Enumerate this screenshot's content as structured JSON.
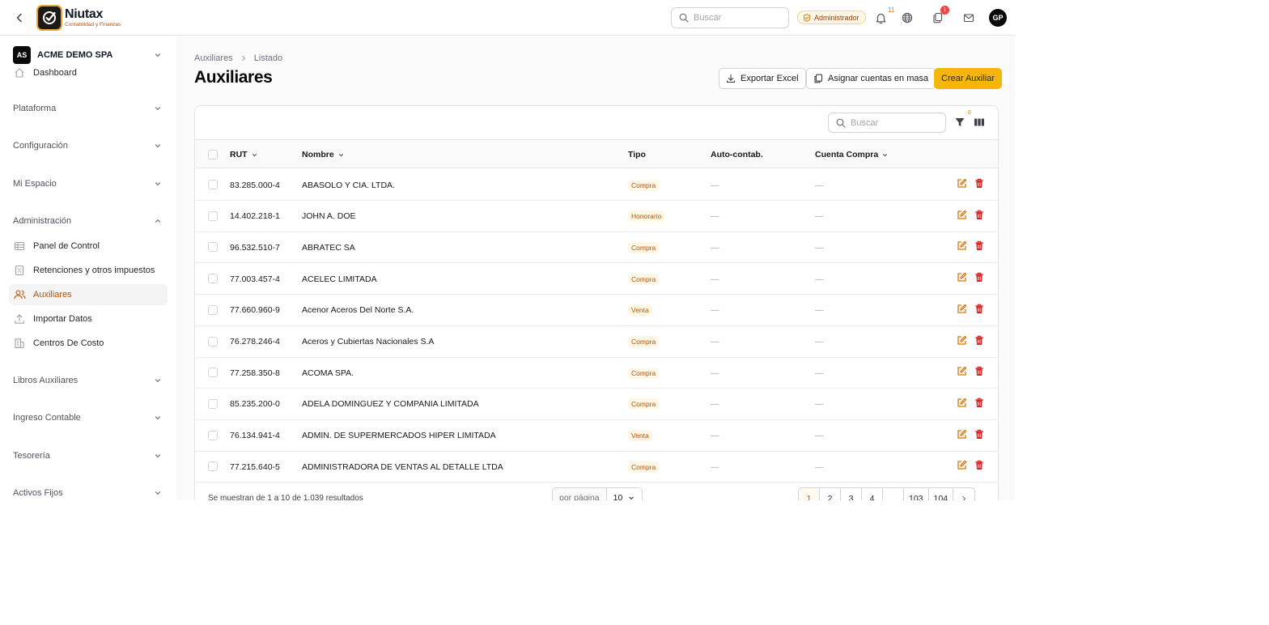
{
  "topbar": {
    "logo_name": "Niutax",
    "logo_subtitle": "Contabilidad y Finanzas",
    "search_placeholder": "Buscar",
    "role_badge": "Administrador",
    "notifications_count": "11",
    "tasks_count": "1",
    "user_initials": "GP"
  },
  "sidebar": {
    "company_initials": "AS",
    "company_name": "ACME DEMO SPA",
    "dashboard_label": "Dashboard",
    "sections": [
      {
        "label": "Plataforma",
        "expanded": false
      },
      {
        "label": "Configuración",
        "expanded": false
      },
      {
        "label": "Mi Espacio",
        "expanded": false
      },
      {
        "label": "Administración",
        "expanded": true
      },
      {
        "label": "Libros Auxiliares",
        "expanded": false
      },
      {
        "label": "Ingreso Contable",
        "expanded": false
      },
      {
        "label": "Tesorería",
        "expanded": false
      },
      {
        "label": "Activos Fijos",
        "expanded": false
      }
    ],
    "admin_items": [
      {
        "label": "Panel de Control",
        "icon": "table-icon"
      },
      {
        "label": "Retenciones y otros impuestos",
        "icon": "receipt-icon"
      },
      {
        "label": "Auxiliares",
        "icon": "users-icon",
        "active": true
      },
      {
        "label": "Importar Datos",
        "icon": "upload-icon"
      },
      {
        "label": "Centros De Costo",
        "icon": "building-icon"
      }
    ]
  },
  "breadcrumb": [
    "Auxiliares",
    "Listado"
  ],
  "page_title": "Auxiliares",
  "actions": {
    "export": "Exportar Excel",
    "assign": "Asignar cuentas en masa",
    "create": "Crear Auxiliar"
  },
  "table": {
    "search_placeholder": "Buscar",
    "filter_count": "0",
    "columns": {
      "rut": "RUT",
      "nombre": "Nombre",
      "tipo": "Tipo",
      "auto": "Auto-contab.",
      "cuenta": "Cuenta Compra"
    },
    "rows": [
      {
        "rut": "83.285.000-4",
        "nombre": "ABASOLO Y CIA. LTDA.",
        "tipo": "Compra",
        "auto": "—",
        "cuenta": "—"
      },
      {
        "rut": "14.402.218-1",
        "nombre": "JOHN A. DOE",
        "tipo": "Honorario",
        "auto": "—",
        "cuenta": "—"
      },
      {
        "rut": "96.532.510-7",
        "nombre": "ABRATEC SA",
        "tipo": "Compra",
        "auto": "—",
        "cuenta": "—"
      },
      {
        "rut": "77.003.457-4",
        "nombre": "ACELEC LIMITADA",
        "tipo": "Compra",
        "auto": "—",
        "cuenta": "—"
      },
      {
        "rut": "77.660.960-9",
        "nombre": "Acenor Aceros Del Norte S.A.",
        "tipo": "Venta",
        "auto": "—",
        "cuenta": "—"
      },
      {
        "rut": "76.278.246-4",
        "nombre": "Aceros y Cubiertas Nacionales S.A",
        "tipo": "Compra",
        "auto": "—",
        "cuenta": "—"
      },
      {
        "rut": "77.258.350-8",
        "nombre": "ACOMA SPA.",
        "tipo": "Compra",
        "auto": "—",
        "cuenta": "—"
      },
      {
        "rut": "85.235.200-0",
        "nombre": "ADELA DOMINGUEZ Y COMPANIA LIMITADA",
        "tipo": "Compra",
        "auto": "—",
        "cuenta": "—"
      },
      {
        "rut": "76.134.941-4",
        "nombre": "ADMIN. DE SUPERMERCADOS HIPER LIMITADA",
        "tipo": "Venta",
        "auto": "—",
        "cuenta": "—"
      },
      {
        "rut": "77.215.640-5",
        "nombre": "ADMINISTRADORA DE VENTAS AL DETALLE LTDA",
        "tipo": "Compra",
        "auto": "—",
        "cuenta": "—"
      }
    ],
    "footer_text": "Se muestran de 1 a 10 de 1.039 resultados",
    "per_page_label": "por página",
    "per_page_value": "10",
    "pages": [
      "1",
      "2",
      "3",
      "4",
      "...",
      "103",
      "104"
    ],
    "current_page": "1"
  },
  "colors": {
    "accent": "#f5b50a",
    "accent_text": "#b45309",
    "danger": "#dc2626"
  }
}
